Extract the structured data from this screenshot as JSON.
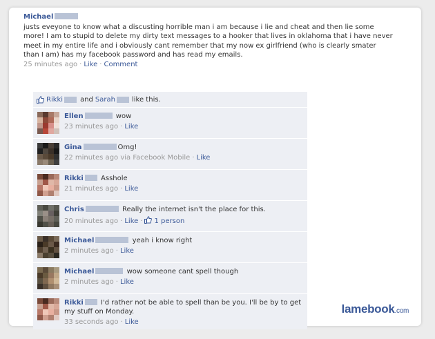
{
  "post": {
    "author": "Michael",
    "text": "justs eveyone to know what a discusting horrible man i am because i lie and cheat and then lie some more! I am to stupid to delete my dirty text messages to a hooker that lives in oklahoma that i have never meet in my entire life and i obviously cant remember that my now ex girlfriend (who is clearly smater than I am) has my facebook password and has read my emails.",
    "time": "25 minutes ago",
    "like_label": "Like",
    "comment_label": "Comment"
  },
  "likes": {
    "person1": "Rikki",
    "and": "and",
    "person2": "Sarah",
    "suffix": "like this."
  },
  "comments": [
    {
      "author": "Ellen",
      "text": "wow",
      "time": "23 minutes ago",
      "via": "",
      "like_label": "Like",
      "likes_count": ""
    },
    {
      "author": "Gina",
      "text": "Omg!",
      "time": "22 minutes ago via Facebook Mobile",
      "via": "",
      "like_label": "Like",
      "likes_count": ""
    },
    {
      "author": "Rikki",
      "text": "Asshole",
      "time": "21 minutes ago",
      "via": "",
      "like_label": "Like",
      "likes_count": ""
    },
    {
      "author": "Chris",
      "text": "Really the internet isn't the place for this.",
      "time": "20 minutes ago",
      "via": "",
      "like_label": "Like",
      "likes_count": "1 person"
    },
    {
      "author": "Michael",
      "text": "yeah i know right",
      "time": "2 minutes ago",
      "via": "",
      "like_label": "Like",
      "likes_count": ""
    },
    {
      "author": "Michael",
      "text": "wow someone cant spell though",
      "time": "2 minutes ago",
      "via": "",
      "like_label": "Like",
      "likes_count": ""
    },
    {
      "author": "Rikki",
      "text": "I'd rather not be able to spell than be you. I'll be by to get my stuff on Monday.",
      "time": "33 seconds ago",
      "via": "",
      "like_label": "Like",
      "likes_count": ""
    }
  ],
  "brand": {
    "name": "lamebook",
    "tld": ".com"
  },
  "colors": {
    "link": "#3b5998",
    "feedback_bg": "#edeff4",
    "meta": "#999999"
  }
}
